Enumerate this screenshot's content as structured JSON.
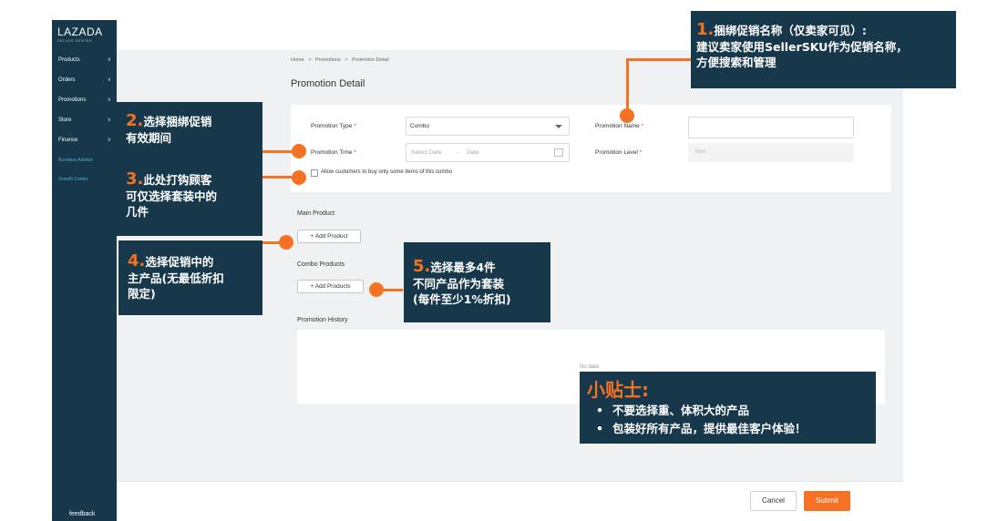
{
  "sidebar": {
    "logo": "LAZADA",
    "logo_sub": "SELLER CENTER",
    "items": [
      {
        "label": "Products"
      },
      {
        "label": "Orders"
      },
      {
        "label": "Promotions"
      },
      {
        "label": "Store"
      },
      {
        "label": "Finance"
      }
    ],
    "links": [
      "Business Advisor",
      "Growth Center"
    ],
    "feedback": "feedback"
  },
  "breadcrumb": [
    "Home",
    ">",
    "Promotions",
    ">",
    "Promotion Detail"
  ],
  "page_title": "Promotion Detail",
  "form": {
    "promotion_type_label": "Promotion Type",
    "promotion_type_value": "Combo",
    "promotion_name_label": "Promotion Name",
    "promotion_time_label": "Promotion Time",
    "start_date_placeholder": "Select Date",
    "date_dash": "-",
    "end_date_placeholder": "Date",
    "promotion_level_label": "Promotion Level",
    "promotion_level_value": "Item",
    "required_mark": "*",
    "checkbox_label": "Allow customers to buy only some items of this combo"
  },
  "main_product": {
    "label": "Main Product",
    "button": "+ Add Product"
  },
  "combo_products": {
    "label": "Combo Products",
    "button": "+ Add Products"
  },
  "history": {
    "label": "Promotion History",
    "empty": "No data"
  },
  "footer": {
    "cancel": "Cancel",
    "submit": "Submit"
  },
  "annotations": {
    "n1": {
      "num": "1.",
      "title": "捆绑促销名称（仅卖家可见）:",
      "line1": "建议卖家使用SellerSKU作为促销名称，",
      "line2": "方便搜索和管理"
    },
    "n2": {
      "num": "2.",
      "title": "选择捆绑促销",
      "line1": "有效期间"
    },
    "n3": {
      "num": "3.",
      "title": "此处打钩顾客",
      "line1": "可仅选择套装中的",
      "line2": "几件"
    },
    "n4": {
      "num": "4.",
      "title": "选择促销中的",
      "line1": "主产品(无最低折扣",
      "line2": "限定)"
    },
    "n5": {
      "num": "5.",
      "title": "选择最多4件",
      "line1": "不同产品作为套装",
      "line2": "(每件至少1%折扣)"
    },
    "tips": {
      "title": "小贴士:",
      "bullet": "•",
      "item1": "不要选择重、体积大的产品",
      "item2": "包装好所有产品，提供最佳客户体验！"
    }
  },
  "colors": {
    "sidebar": "#16384a",
    "accent": "#f57224",
    "background": "#f0f1f3"
  }
}
